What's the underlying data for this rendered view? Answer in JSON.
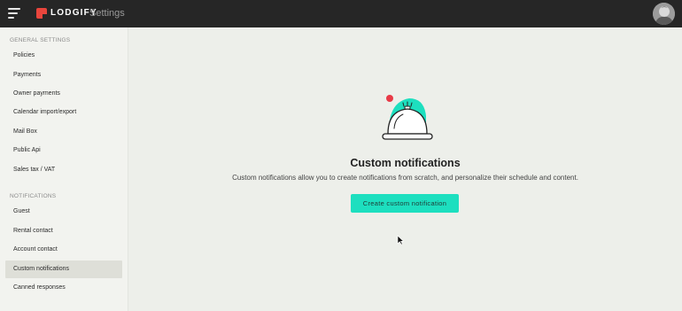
{
  "header": {
    "brand": "LODGIFY",
    "title": "Settings",
    "colors": {
      "bar": "#262626",
      "brand_mark": "#e8453c"
    }
  },
  "sidebar": {
    "sections": [
      {
        "title": "GENERAL SETTINGS",
        "items": [
          "Policies",
          "Payments",
          "Owner payments",
          "Calendar import/export",
          "Mail Box",
          "Public Api",
          "Sales tax / VAT"
        ]
      },
      {
        "title": "NOTIFICATIONS",
        "items": [
          "Guest",
          "Rental contact",
          "Account contact",
          "Custom notifications",
          "Canned responses"
        ]
      }
    ],
    "active_item": "Custom notifications"
  },
  "main": {
    "heading": "Custom notifications",
    "description": "Custom notifications allow you to create notifications from scratch, and personalize their schedule and content.",
    "cta_label": "Create  custom  notification",
    "colors": {
      "accent": "#1ddfbf",
      "bell_dot": "#e83a47"
    }
  }
}
